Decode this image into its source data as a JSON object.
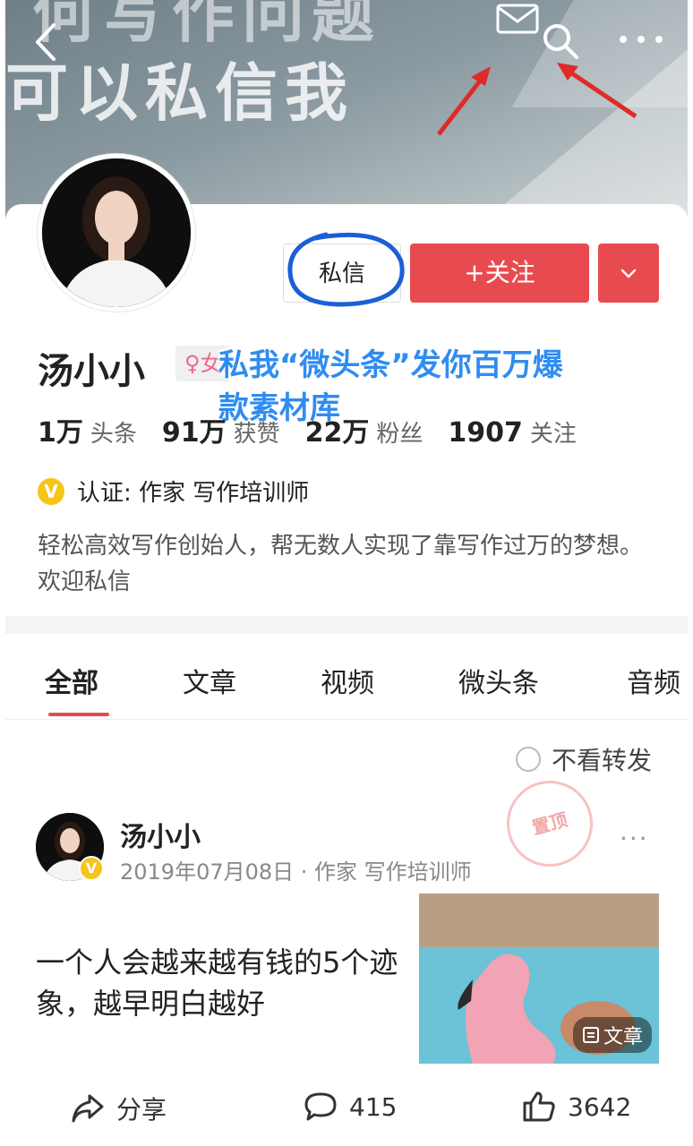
{
  "banner": {
    "text_line1": "何写作问题",
    "text_line2": "可以私信我"
  },
  "nav": {
    "back_icon": "chevron-left-icon",
    "message_icon": "message-icon",
    "search_icon": "search-icon",
    "more_icon": "more-dots-icon"
  },
  "profile": {
    "dm_label": "私信",
    "follow_label": "+关注",
    "name": "汤小小",
    "gender": "♀女",
    "overlay_line1": "私我“微头条”发你百万爆",
    "overlay_line2": "款素材库",
    "stats": [
      {
        "num": "1万",
        "label": "头条"
      },
      {
        "num": "91万",
        "label": "获赞"
      },
      {
        "num": "22万",
        "label": "粉丝"
      },
      {
        "num": "1907",
        "label": "关注"
      }
    ],
    "verify_badge": "V",
    "verify_text": "认证:  作家 写作培训师",
    "bio": "轻松高效写作创始人，帮无数人实现了靠写作过万的梦想。欢迎私信"
  },
  "tabs": [
    {
      "label": "全部",
      "active": true
    },
    {
      "label": "文章"
    },
    {
      "label": "视频"
    },
    {
      "label": "微头条"
    },
    {
      "label": "音频"
    }
  ],
  "filter": {
    "label": "不看转发"
  },
  "stamp": {
    "label": "置顶"
  },
  "post": {
    "author": "汤小小",
    "meta": "2019年07月08日 · 作家 写作培训师",
    "more": "···",
    "title": "一个人会越来越有钱的5个迹象，越早明白越好",
    "thumb_badge": "文章"
  },
  "actions": {
    "share_label": "分享",
    "comment_count": "415",
    "like_count": "3642"
  },
  "colors": {
    "accent": "#e84b4f",
    "annotation_blue": "#2f8cf0",
    "verify_gold": "#f5c518"
  }
}
